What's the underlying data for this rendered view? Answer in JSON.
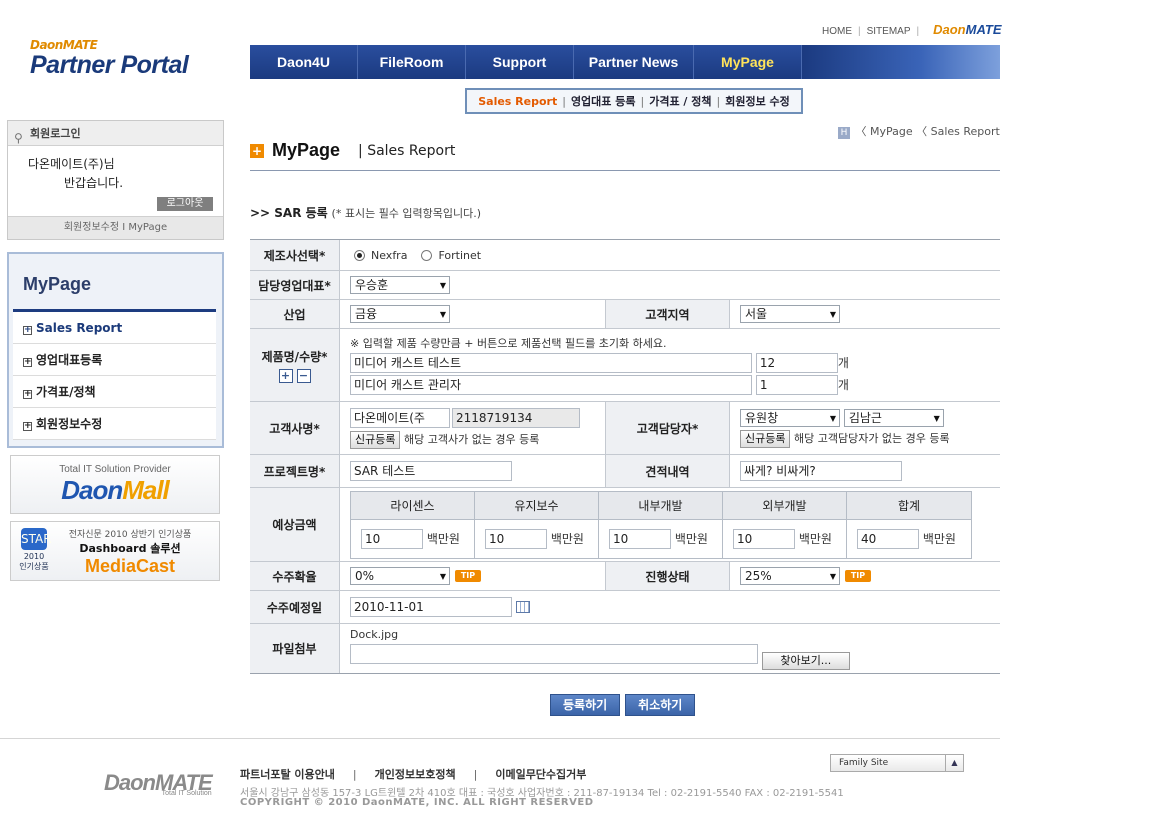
{
  "logo": {
    "top": "DaonMATE",
    "main": "Partner Portal"
  },
  "util": {
    "home": "HOME",
    "sitemap": "SITEMAP",
    "brand_a": "Daon",
    "brand_b": "MATE"
  },
  "gnb": [
    "Daon4U",
    "FileRoom",
    "Support",
    "Partner News",
    "MyPage"
  ],
  "lnb": [
    "Sales Report",
    "영업대표 등록",
    "가격표 / 정책",
    "회원정보 수정"
  ],
  "login": {
    "title": "회원로그인",
    "name": "다온메이트(주)님",
    "greet": "반갑습니다.",
    "logout": "로그아웃",
    "footer": "회원정보수정 I MyPage"
  },
  "mymenu": {
    "title": "MyPage",
    "items": [
      "Sales Report",
      "영업대표등록",
      "가격표/정책",
      "회원정보수정"
    ]
  },
  "banners": {
    "mall_small": "Total IT Solution Provider",
    "mall_a": "Daon",
    "mall_b": "Mall",
    "mc_star_top": "STAR",
    "mc_star_bottom": "2010 인기상품",
    "mc_line1": "전자신문 2010 상반기 인기상품",
    "mc_line2": "Dashboard 솔루션",
    "mc_line3": "MediaCast"
  },
  "breadcrumb": {
    "icon": "H",
    "path": "〈 MyPage 〈 Sales Report"
  },
  "page": {
    "title": "MyPage",
    "subtitle": "| Sales Report"
  },
  "form": {
    "heading": ">> SAR 등록",
    "note": "(* 표시는 필수 입력항목입니다.)",
    "labels": {
      "maker": "제조사선택*",
      "rep": "담당영업대표*",
      "industry": "산업",
      "region": "고객지역",
      "product": "제품명/수량*",
      "customer": "고객사명*",
      "contact": "고객담당자*",
      "project": "프로젝트명*",
      "estimate": "견적내역",
      "amount": "예상금액",
      "probability": "수주확율",
      "status": "진행상태",
      "date": "수주예정일",
      "file": "파일첨부"
    },
    "maker_options": [
      "Nexfra",
      "Fortinet"
    ],
    "rep_value": "우승훈",
    "industry_value": "금융",
    "region_value": "서울",
    "product_hint": "※ 입력할 제품 수량만큼 + 버튼으로 제품선택 필드를 초기화 하세요.",
    "products": [
      {
        "name": "미디어 캐스트 테스트",
        "qty": "12",
        "unit": "개"
      },
      {
        "name": "미디어 캐스트 관리자",
        "qty": "1",
        "unit": "개"
      }
    ],
    "customer_value": "다온메이트(주",
    "customer_code": "2118719134",
    "new_btn": "신규등록",
    "customer_hint": "해당 고객사가 없는 경우 등록",
    "contact_value1": "유원창",
    "contact_value2": "김남근",
    "contact_hint": "해당 고객담당자가 없는 경우 등록",
    "project_value": "SAR 테스트",
    "estimate_value": "싸게? 비싸게?",
    "cost_headers": [
      "라이센스",
      "유지보수",
      "내부개발",
      "외부개발",
      "합계"
    ],
    "cost_values": [
      "10",
      "10",
      "10",
      "10",
      "40"
    ],
    "cost_unit": "백만원",
    "probability_value": "0%",
    "status_value": "25%",
    "tip": "TIP",
    "date_value": "2010-11-01",
    "file_name": "Dock.jpg",
    "browse": "찾아보기..."
  },
  "actions": {
    "submit": "등록하기",
    "cancel": "취소하기"
  },
  "footer": {
    "logo": "DaonMATE",
    "logo_tag": "Total IT Solution",
    "links": [
      "파트너포탈 이용안내",
      "개인정보보호정책",
      "이메일무단수집거부"
    ],
    "address": "서울시 강남구 삼성동 157-3 LG트윈텔 2차 410호   대표 : 국성호  사업자번호 : 211-87-19134    Tel : 02-2191-5540    FAX : 02-2191-5541",
    "copyright": "COPYRIGHT © 2010 DaonMATE, INC. ALL RIGHT RESERVED",
    "family": "Family Site"
  }
}
